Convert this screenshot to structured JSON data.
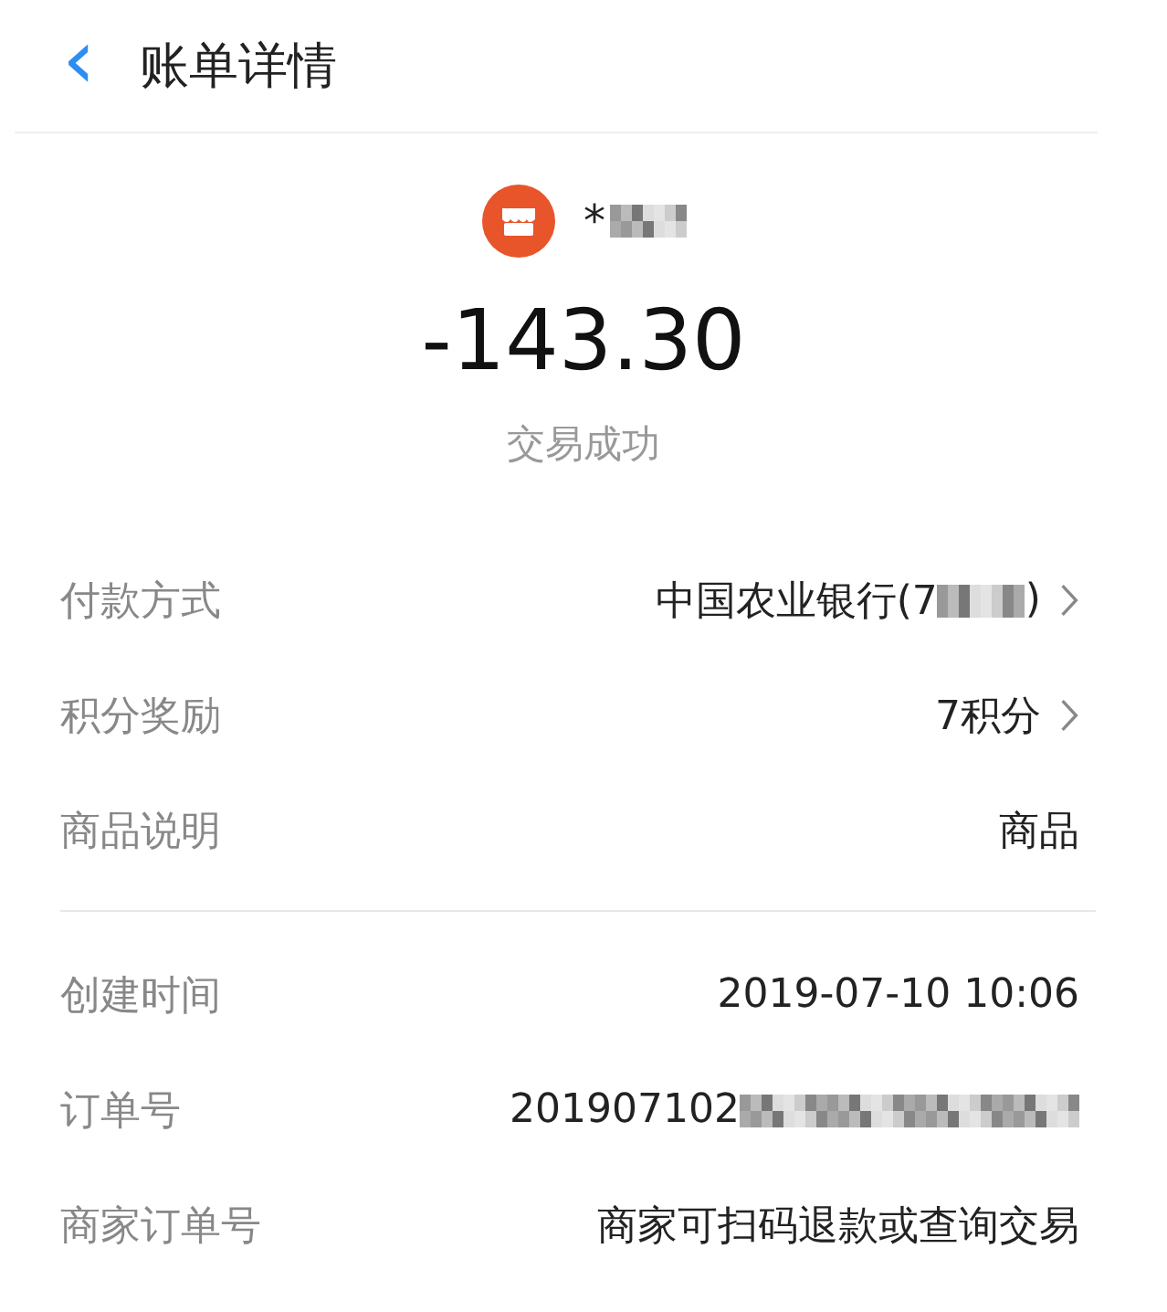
{
  "header": {
    "back": "‹",
    "title": "账单详情"
  },
  "summary": {
    "name_start": "*",
    "name_redacted": true,
    "amount": "-143.30",
    "status": "交易成功"
  },
  "sections": [
    {
      "rows": [
        {
          "label": "付款方式",
          "value": "中国农业银行(7",
          "redacted": true,
          "value_end": ")",
          "arrow": true
        },
        {
          "label": "积分奖励",
          "value": "7积分",
          "redacted": false,
          "arrow": true
        },
        {
          "label": "商品说明",
          "value": "商品",
          "redacted": false,
          "arrow": false
        }
      ]
    },
    {
      "rows": [
        {
          "label": "创建时间",
          "value": "2019-07-10 10:06",
          "redacted": false,
          "arrow": false
        },
        {
          "label": "订单号",
          "value": "201907102",
          "redacted": true,
          "arrow": false
        },
        {
          "label": "商家订单号",
          "value": "商家可扫码退款或查询交易",
          "redacted": false,
          "arrow": false
        }
      ]
    }
  ]
}
